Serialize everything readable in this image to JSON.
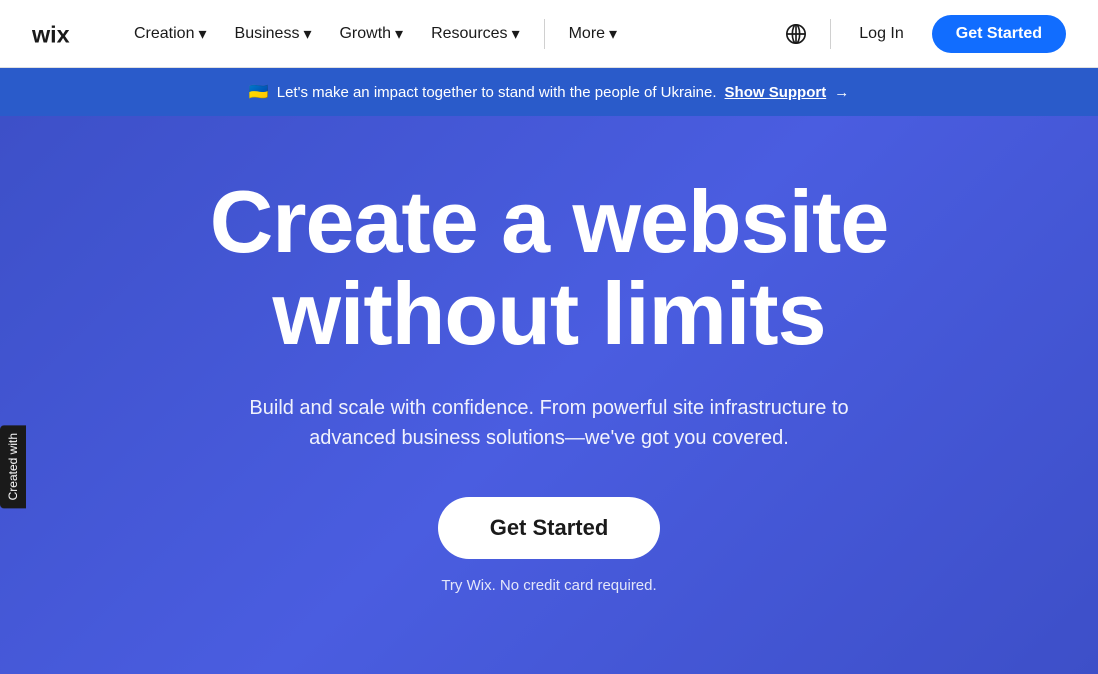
{
  "logo": {
    "alt": "Wix"
  },
  "navbar": {
    "items": [
      {
        "label": "Creation",
        "has_dropdown": true
      },
      {
        "label": "Business",
        "has_dropdown": true
      },
      {
        "label": "Growth",
        "has_dropdown": true
      },
      {
        "label": "Resources",
        "has_dropdown": true
      }
    ],
    "more_label": "More",
    "login_label": "Log In",
    "get_started_label": "Get Started"
  },
  "banner": {
    "flag_emoji": "🇺🇦",
    "text": "Let's make an impact together to stand with the people of Ukraine.",
    "link_label": "Show Support",
    "arrow": "→"
  },
  "hero": {
    "title_line1": "Create a website",
    "title_line2": "without limits",
    "subtitle": "Build and scale with confidence. From powerful site infrastructure to advanced business solutions—we've got you covered.",
    "cta_label": "Get Started",
    "disclaimer": "Try Wix. No credit card required."
  },
  "side_tab": {
    "label": "Created with"
  },
  "icons": {
    "chevron": "▾",
    "globe": "🌐"
  }
}
